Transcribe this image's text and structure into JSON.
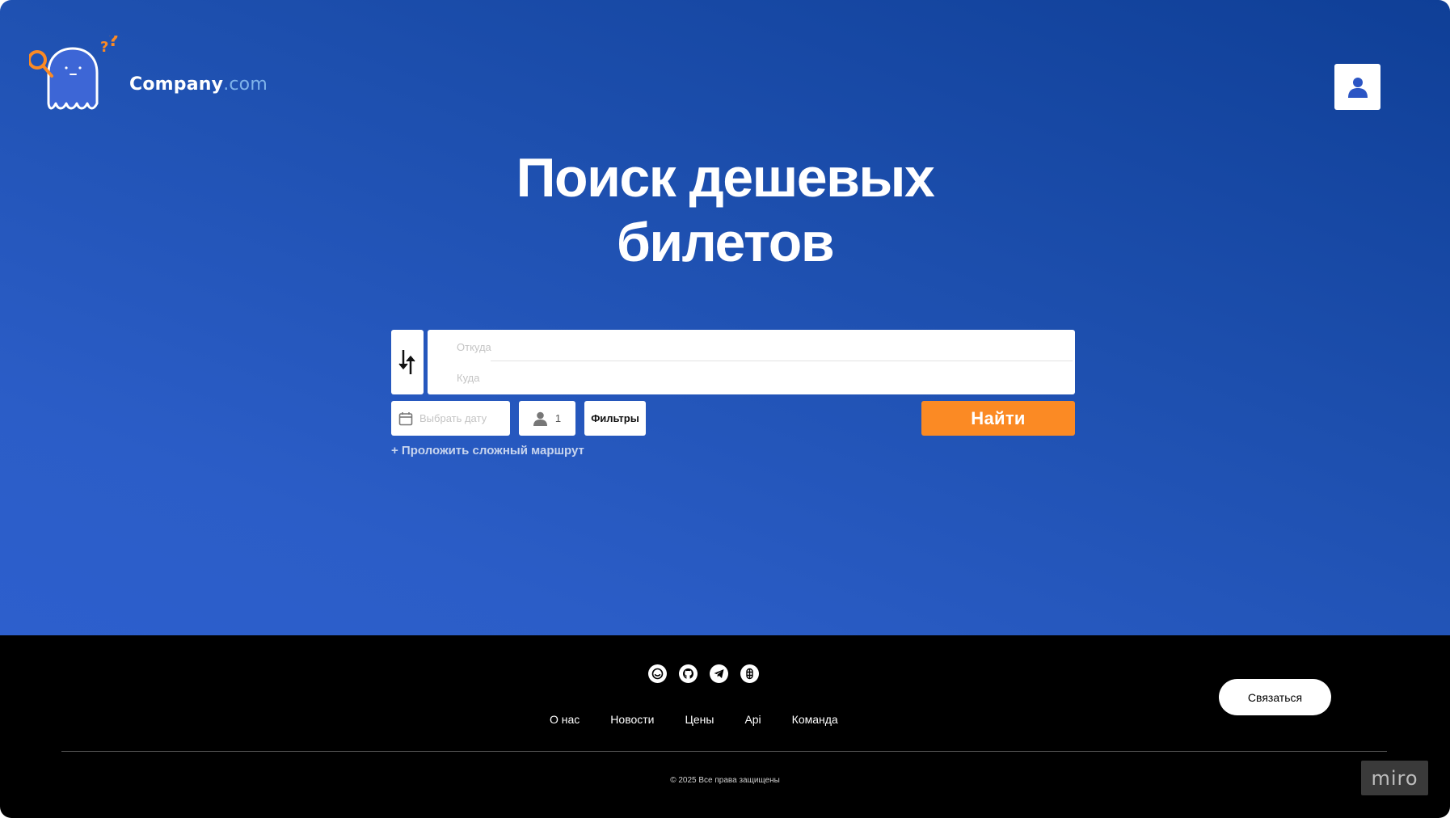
{
  "header": {
    "brand_name": "Company",
    "brand_domain": ".com",
    "logo_icon": "ghost-with-magnifier-icon",
    "profile_icon": "user-icon"
  },
  "hero": {
    "title_line1": "Поиск дешевых",
    "title_line2": "билетов"
  },
  "search_form": {
    "swap_icon": "swap-arrows-icon",
    "from_placeholder": "Откуда",
    "from_value": "",
    "to_placeholder": "Куда",
    "to_value": "",
    "date_placeholder": "Выбрать дату",
    "date_icon": "calendar-icon",
    "passengers_icon": "user-icon",
    "passengers_count": "1",
    "filters_label": "Фильтры",
    "search_label": "Найти",
    "complex_route_label": "+ Проложить сложный маршрут"
  },
  "footer": {
    "social_icons": [
      "smile-icon",
      "github-icon",
      "telegram-icon",
      "figma-icon"
    ],
    "nav": [
      "О нас",
      "Новости",
      "Цены",
      "Api",
      "Команда"
    ],
    "contact_label": "Связаться",
    "copyright": "© 2025 Все права защищены"
  },
  "miro_badge": "miro",
  "colors": {
    "hero_top": "#0f3f97",
    "hero_bottom": "#2d5fcd",
    "accent": "#fb8a24",
    "footer_bg": "#000000",
    "domain_text": "#7fb3ea"
  }
}
